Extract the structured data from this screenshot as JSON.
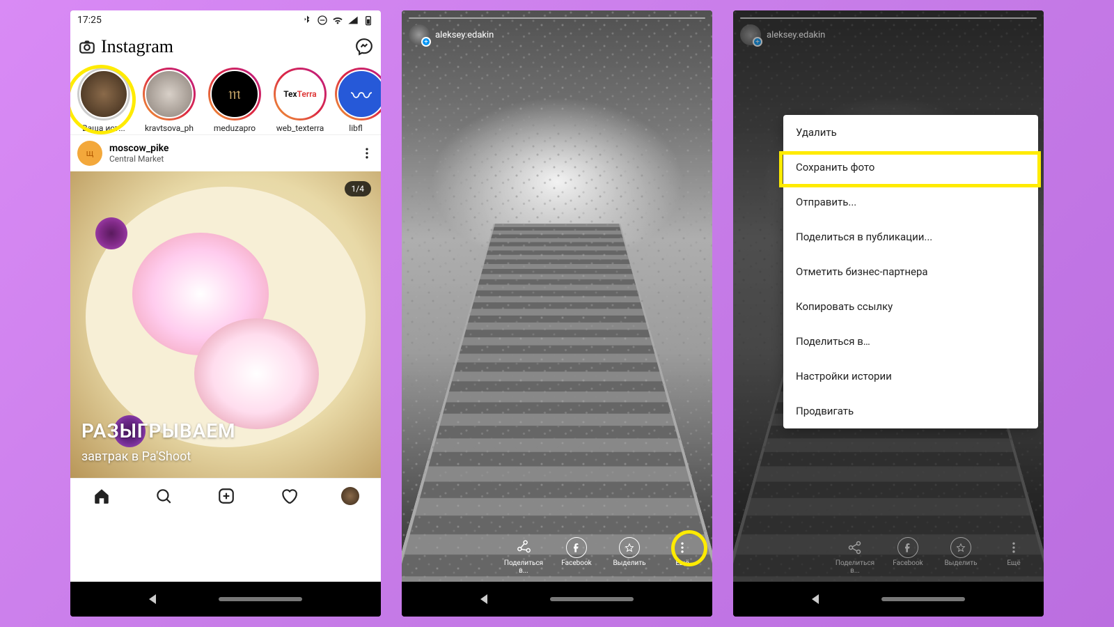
{
  "status": {
    "time": "17:25"
  },
  "header": {
    "logo": "Instagram"
  },
  "stories": {
    "items": [
      {
        "label": "Ваша ист...",
        "avatarColor": "#6b5142"
      },
      {
        "label": "kravtsova_ph",
        "avatarColor": "#a8a19a"
      },
      {
        "label": "meduzapro",
        "avatarColor": "#000000",
        "letter": "𝔪"
      },
      {
        "label": "web_texterra",
        "avatarColor": "#ffffff",
        "text": "TexTerra"
      },
      {
        "label": "libfl",
        "avatarColor": "#2659d8",
        "text": "~"
      }
    ]
  },
  "post": {
    "avatar_letter": "щ",
    "username": "moscow_pike",
    "location": "Central Market",
    "counter": "1/4",
    "caption1": "РАЗЫГРЫВАЕМ",
    "caption2": "завтрак в Pa'Shoot"
  },
  "story_view": {
    "username": "aleksey.edakin",
    "actions": {
      "share": "Поделиться в...",
      "facebook": "Facebook",
      "highlight": "Выделить",
      "more": "Ещё"
    }
  },
  "menu": {
    "items": [
      "Удалить",
      "Сохранить фото",
      "Отправить...",
      "Поделиться в публикации...",
      "Отметить бизнес-партнера",
      "Копировать ссылку",
      "Поделиться в…",
      "Настройки истории",
      "Продвигать"
    ]
  }
}
